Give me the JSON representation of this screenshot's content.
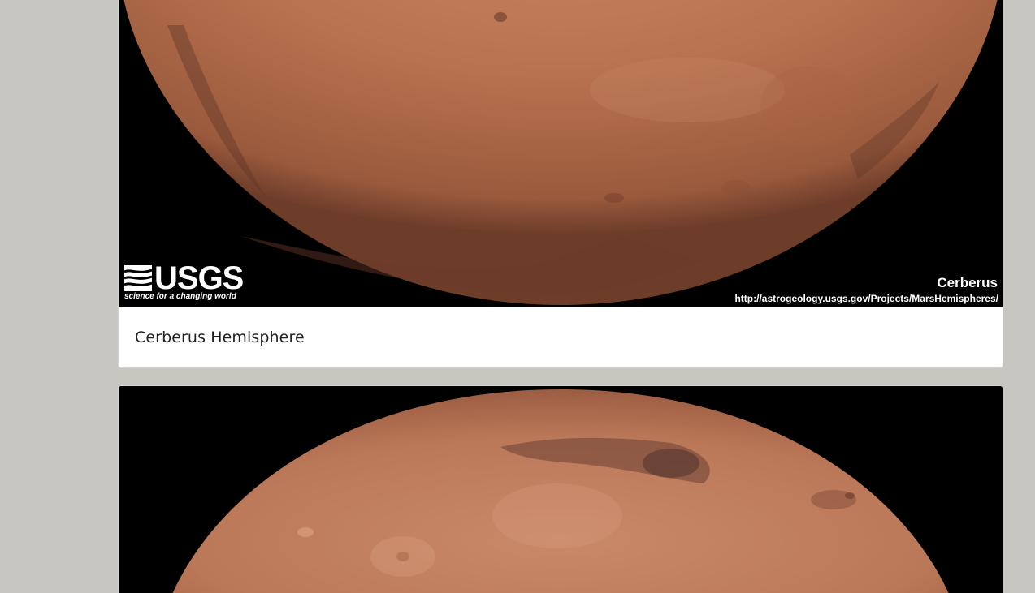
{
  "cards": [
    {
      "title": "Cerberus Hemisphere",
      "image": {
        "logo_text": "USGS",
        "logo_tagline": "science for a changing world",
        "caption_title": "Cerberus",
        "caption_url": "http://astrogeology.usgs.gov/Projects/MarsHemispheres/"
      }
    },
    {
      "title": "",
      "image": {}
    }
  ],
  "colors": {
    "page_background": "#c8c6c0",
    "card_background": "#ffffff",
    "image_background": "#000000",
    "planet_primary": "#b9724f",
    "planet_dark": "#5a3326"
  }
}
